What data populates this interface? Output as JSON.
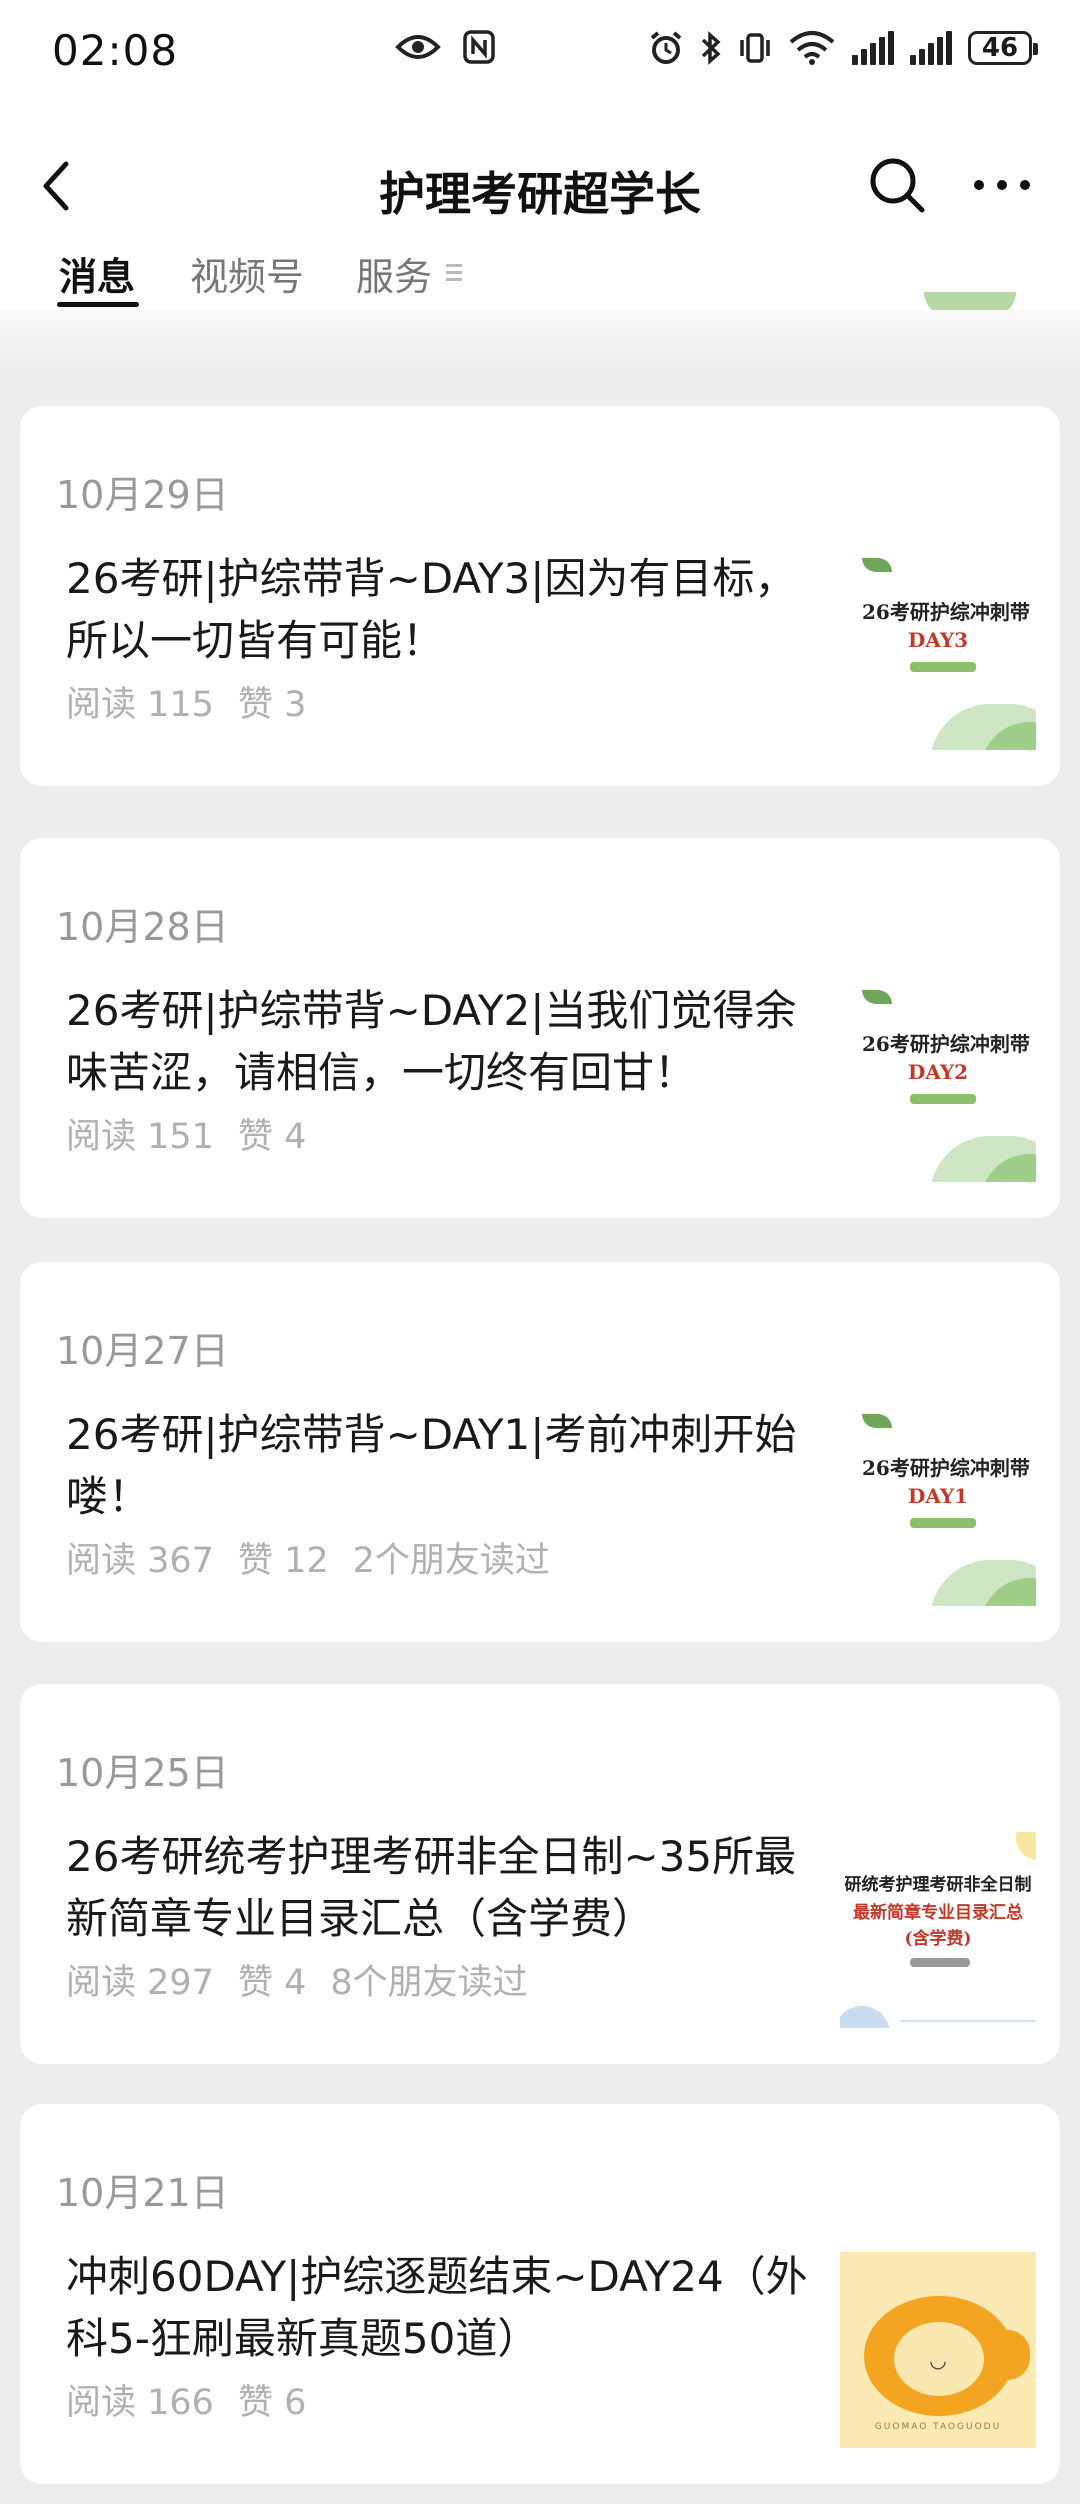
{
  "status_bar": {
    "time": "02:08",
    "battery": "46"
  },
  "nav": {
    "title": "护理考研超学长"
  },
  "tabs": [
    {
      "label": "消息",
      "active": true
    },
    {
      "label": "视频号",
      "active": false
    },
    {
      "label": "服务",
      "active": false
    }
  ],
  "articles": [
    {
      "date": "10月29日",
      "title": "26考研|护综带背~DAY3|因为有目标，所以一切皆有可能！",
      "reads": "阅读 115",
      "likes": "赞 3",
      "friends": "",
      "thumb": {
        "line1": "26考研护综冲刺带",
        "line2": "DAY3"
      }
    },
    {
      "date": "10月28日",
      "title": "26考研|护综带背~DAY2|当我们觉得余味苦涩，请相信，一切终有回甘！",
      "reads": "阅读 151",
      "likes": "赞 4",
      "friends": "",
      "thumb": {
        "line1": "26考研护综冲刺带",
        "line2": "DAY2"
      }
    },
    {
      "date": "10月27日",
      "title": "26考研|护综带背~DAY1|考前冲刺开始喽！",
      "reads": "阅读 367",
      "likes": "赞 12",
      "friends": "2个朋友读过",
      "thumb": {
        "line1": "26考研护综冲刺带",
        "line2": "DAY1"
      }
    },
    {
      "date": "10月25日",
      "title": "26考研统考护理考研非全日制~35所最新简章专业目录汇总（含学费）",
      "reads": "阅读 297",
      "likes": "赞 4",
      "friends": "8个朋友读过",
      "thumb": {
        "line1": "研统考护理考研非全日制",
        "line2": "最新简章专业目录汇总",
        "line3": "(含学费)"
      }
    },
    {
      "date": "10月21日",
      "title": "冲刺60DAY|护综逐题结束~DAY24（外科5-狂刷最新真题50道）",
      "reads": "阅读 166",
      "likes": "赞 6",
      "friends": "",
      "thumb": {
        "caption": "GUOMAO TAOGUODU"
      }
    }
  ]
}
